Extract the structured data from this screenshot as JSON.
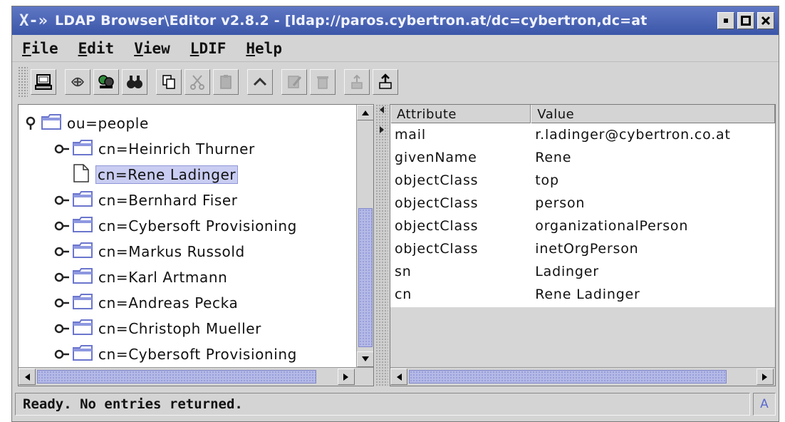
{
  "window": {
    "title": "LDAP Browser\\Editor v2.8.2 - [ldap://paros.cybertron.at/dc=cybertron,dc=at",
    "buttons": [
      "minimize",
      "maximize",
      "close"
    ]
  },
  "menu": [
    "File",
    "Edit",
    "View",
    "LDIF",
    "Help"
  ],
  "toolbar": {
    "buttons": [
      {
        "icon": "connect-computer-icon",
        "enabled": true
      },
      {
        "icon": "reconnect-icon",
        "enabled": true
      },
      {
        "icon": "search-users-icon",
        "enabled": true
      },
      {
        "icon": "binoculars-icon",
        "enabled": true
      },
      {
        "icon": "copy-icon",
        "enabled": true
      },
      {
        "icon": "cut-icon",
        "enabled": false
      },
      {
        "icon": "paste-icon",
        "enabled": false
      },
      {
        "icon": "up-icon",
        "enabled": true
      },
      {
        "icon": "edit-icon",
        "enabled": false
      },
      {
        "icon": "delete-icon",
        "enabled": false
      },
      {
        "icon": "add-entry-icon",
        "enabled": false
      },
      {
        "icon": "export-icon",
        "enabled": true
      }
    ]
  },
  "tree": {
    "root": "ou=people",
    "items": [
      {
        "label": "cn=Heinrich Thurner",
        "type": "folder",
        "selected": false
      },
      {
        "label": "cn=Rene Ladinger",
        "type": "leaf",
        "selected": true
      },
      {
        "label": "cn=Bernhard Fiser",
        "type": "folder",
        "selected": false
      },
      {
        "label": "cn=Cybersoft Provisioning",
        "type": "folder",
        "selected": false
      },
      {
        "label": "cn=Markus Russold",
        "type": "folder",
        "selected": false
      },
      {
        "label": "cn=Karl Artmann",
        "type": "folder",
        "selected": false
      },
      {
        "label": "cn=Andreas Pecka",
        "type": "folder",
        "selected": false
      },
      {
        "label": "cn=Christoph Mueller",
        "type": "folder",
        "selected": false
      },
      {
        "label": "cn=Cybersoft Provisioning",
        "type": "folder",
        "selected": false
      }
    ]
  },
  "table": {
    "columns": [
      "Attribute",
      "Value"
    ],
    "rows": [
      [
        "mail",
        "r.ladinger@cybertron.co.at"
      ],
      [
        "givenName",
        "Rene"
      ],
      [
        "objectClass",
        "top"
      ],
      [
        "objectClass",
        "person"
      ],
      [
        "objectClass",
        "organizationalPerson"
      ],
      [
        "objectClass",
        "inetOrgPerson"
      ],
      [
        "sn",
        "Ladinger"
      ],
      [
        "cn",
        "Rene Ladinger"
      ]
    ]
  },
  "status": {
    "text": "Ready. No entries returned.",
    "mode": "A"
  },
  "colors": {
    "title_bar": "#3b56a8",
    "selection": "#c9cdf2",
    "scroll_thumb": "#b4b9e6",
    "folder": "#7b86d6"
  }
}
